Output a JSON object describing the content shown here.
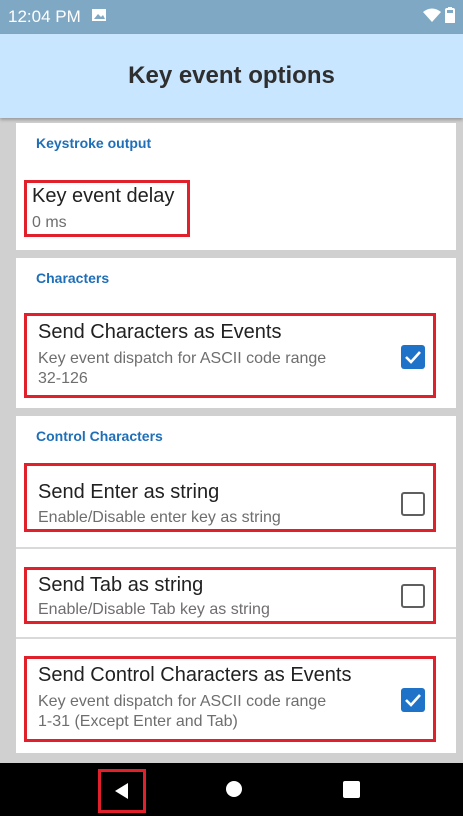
{
  "status_bar": {
    "time": "12:04 PM"
  },
  "app_bar": {
    "title": "Key event options"
  },
  "sections": {
    "keystroke": {
      "header": "Keystroke output",
      "key_delay": {
        "title": "Key event delay",
        "summary": "0 ms"
      }
    },
    "characters": {
      "header": "Characters",
      "send_chars": {
        "title": "Send Characters as Events",
        "summary_line1": "Key event dispatch for ASCII code range",
        "summary_line2": "32-126",
        "checked": true
      }
    },
    "control": {
      "header": "Control Characters",
      "send_enter": {
        "title": "Send Enter as string",
        "summary": "Enable/Disable enter key as string",
        "checked": false
      },
      "send_tab": {
        "title": "Send Tab as string",
        "summary": "Enable/Disable Tab key as string",
        "checked": false
      },
      "send_ctrl": {
        "title": "Send Control Characters as Events",
        "summary_line1": "Key event dispatch for ASCII code range",
        "summary_line2": "1-31 (Except Enter and Tab)",
        "checked": true
      }
    }
  },
  "nav_bar": {
    "back": "back-icon",
    "home": "home-icon",
    "recents": "recents-icon"
  },
  "colors": {
    "accent": "#1e73c8",
    "highlight": "#e0202a",
    "app_bar": "#c8e6ff",
    "status_bar": "#7fa8c4"
  }
}
